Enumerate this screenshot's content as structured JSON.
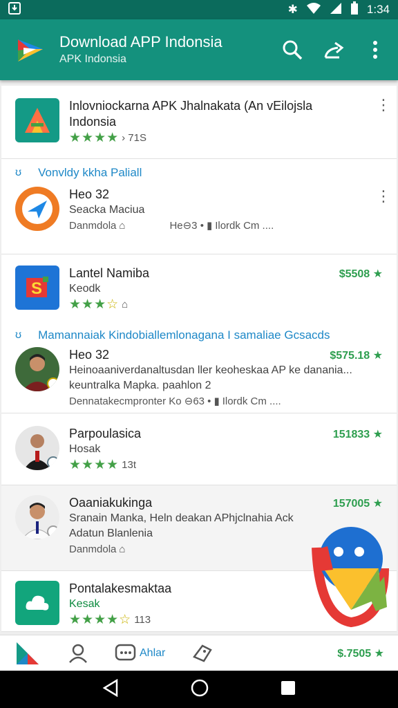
{
  "status_bar": {
    "time": "1:34"
  },
  "app_bar": {
    "title": "Download APP Indonsia",
    "subtitle": "APK Indonsia"
  },
  "items": [
    {
      "name": "Inlovniockarna APK Jhalnakata (An vEilojsla",
      "sub": "Indonsia",
      "count": "› 71S"
    },
    {
      "section": "Vonvldy kkha Paliall",
      "name": "Heo 32",
      "sub": "Seacka Maciua",
      "meta_left": "Danmdola",
      "meta_right": "He⊖3 •",
      "meta_right2": "Ilordk Cm ...."
    },
    {
      "name": "Lantel Namiba",
      "sub": "Keodk",
      "price": "$5508"
    },
    {
      "section": "Mamannaiak Kindobiallemlonagana I samaliae Gcsacds",
      "name": "Heo 32",
      "sub": "Heinoaaniverdanaltusdan ller keoheskaa AP ke danania...",
      "sub2": "keuntralka Mapka. paahlon 2",
      "meta_left": "Dennatakecmpronter Ko ⊖63 •",
      "meta_right2": "Ilordk Cm ....",
      "price": "$575.18"
    },
    {
      "name": "Parpoulasica",
      "sub": "Hosak",
      "count": "13t",
      "price": "151833"
    },
    {
      "name": "Oaaniakukinga",
      "sub": "Sranain Manka, Heln deakan APhjclnahia Ack",
      "sub2": "Adatun Blanlenia",
      "meta_left": "Danmdola",
      "price": "157005"
    },
    {
      "name": "Pontalakesmaktaa",
      "sub": "Kesak",
      "count": "113"
    }
  ],
  "bottom_nav": {
    "tab_label": "Ahlar",
    "price": "$.7505"
  },
  "colors": {
    "status_bar": "#0b6b5c",
    "app_bar": "#14917d",
    "accent_blue": "#1e88c7",
    "price_green": "#2e9e4f"
  }
}
